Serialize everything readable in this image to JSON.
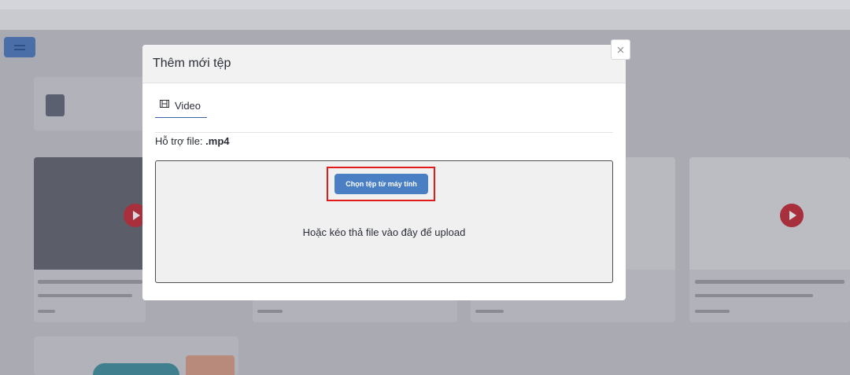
{
  "modal": {
    "title": "Thêm mới tệp",
    "tab_label": "Video",
    "support_label": "Hỗ trợ file: ",
    "support_format": ".mp4",
    "choose_button_label": "Chọn tệp từ máy tính",
    "drop_text": "Hoặc kéo thả file vào đây để upload"
  },
  "colors": {
    "primary_button": "#4a7fc4",
    "highlight_border": "#e21a1a",
    "tab_underline": "#3d64a8"
  },
  "icons": {
    "close": "close-icon",
    "tab": "film-icon"
  }
}
